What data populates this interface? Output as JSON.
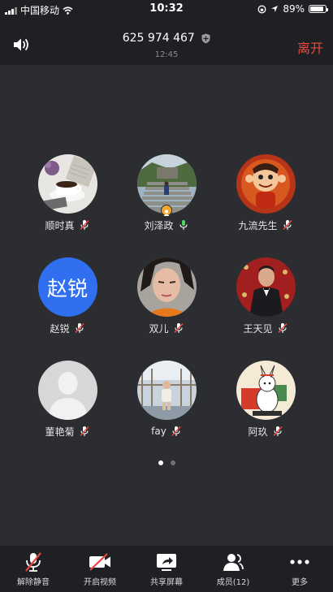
{
  "status_bar": {
    "carrier": "中国移动",
    "time": "10:32",
    "battery_percent": "89%",
    "battery_level": 0.89
  },
  "header": {
    "meeting_id": "625 974 467",
    "elapsed": "12:45",
    "leave_label": "离开"
  },
  "participants": [
    {
      "name": "顺时真",
      "mic": "muted",
      "avatar": "coffee-photo"
    },
    {
      "name": "刘泽政",
      "mic": "on",
      "avatar": "stairs-photo",
      "host": true
    },
    {
      "name": "九流先生",
      "mic": "muted",
      "avatar": "cartoon-monkey"
    },
    {
      "name": "赵锐",
      "mic": "muted",
      "avatar": "text-initials",
      "initials": "赵锐"
    },
    {
      "name": "双儿",
      "mic": "muted",
      "avatar": "selfie-photo"
    },
    {
      "name": "王天见",
      "mic": "muted",
      "avatar": "man-suit-photo"
    },
    {
      "name": "董艳菊",
      "mic": "muted",
      "avatar": "default-silhouette"
    },
    {
      "name": "fay",
      "mic": "muted",
      "avatar": "child-photo"
    },
    {
      "name": "阿玖",
      "mic": "muted",
      "avatar": "cartoon-rabbit"
    }
  ],
  "pagination": {
    "pages": 2,
    "current": 1
  },
  "toolbar": {
    "unmute_label": "解除静音",
    "video_label": "开启视频",
    "share_label": "共享屏幕",
    "members_label": "成员(12)",
    "more_label": "更多"
  },
  "colors": {
    "background": "#2b2d31",
    "bar": "#1e2023",
    "leave": "#e9483f",
    "muted_red": "#e9483f",
    "mic_on_green": "#4cd964",
    "initials_blue": "#2f6ff0"
  }
}
